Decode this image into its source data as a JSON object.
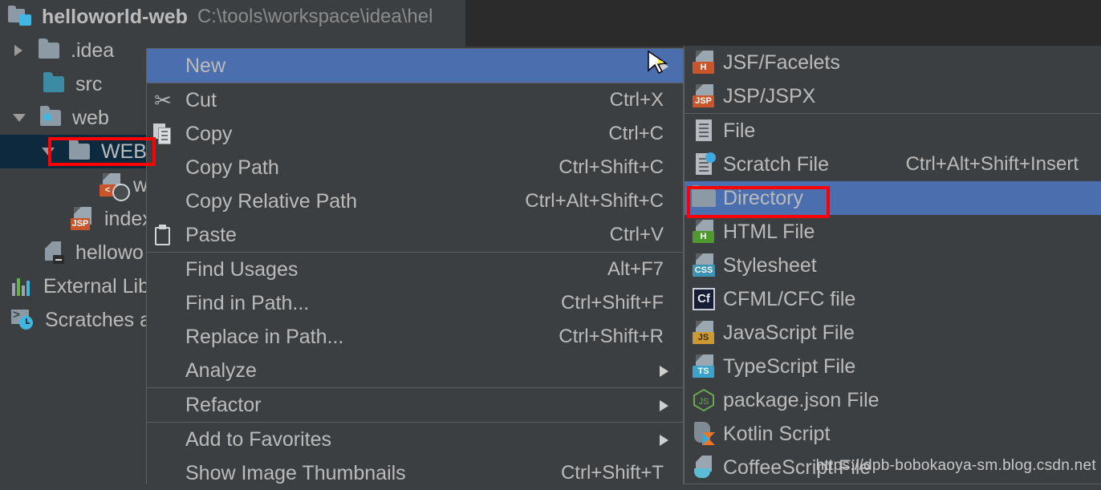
{
  "window": {
    "background_color": "#3c3f41",
    "selection_color": "#4b6eaf",
    "tree_selection_color": "#0d293e",
    "annotation_color": "#fe0000"
  },
  "project_tree": {
    "root": {
      "name": "helloworld-web",
      "path": "C:\\tools\\workspace\\idea\\hel",
      "icon": "project-module-icon"
    },
    "items": [
      {
        "label": ".idea",
        "icon": "folder-icon",
        "indent": 1,
        "expander": "collapsed",
        "selected": false
      },
      {
        "label": "src",
        "icon": "folder-source-icon",
        "indent": 2,
        "expander": "none",
        "selected": false
      },
      {
        "label": "web",
        "icon": "folder-web-icon",
        "indent": 1,
        "expander": "expanded",
        "selected": false
      },
      {
        "label": "WEB-",
        "icon": "folder-icon",
        "indent": 2,
        "expander": "expanded",
        "selected": true
      },
      {
        "label": "w",
        "icon": "xml-web-file-icon",
        "indent": 4,
        "expander": "none",
        "selected": false
      },
      {
        "label": "index",
        "icon": "jsp-file-icon",
        "indent": 3,
        "expander": "none",
        "selected": false
      },
      {
        "label": "hellowo",
        "icon": "module-iml-icon",
        "indent": 2,
        "expander": "none",
        "selected": false
      },
      {
        "label": "External Lib",
        "icon": "external-libraries-icon",
        "indent": 0,
        "expander": "none",
        "selected": false
      },
      {
        "label": "Scratches a",
        "icon": "scratches-icon",
        "indent": 0,
        "expander": "none",
        "selected": false
      }
    ]
  },
  "context_menu": {
    "items": [
      {
        "label": "New",
        "mnemonic": "",
        "accel": "",
        "icon": "",
        "submenu": true,
        "selected": true,
        "separator_after": true
      },
      {
        "label": "Cut",
        "mnemonic": "t",
        "accel": "Ctrl+X",
        "icon": "cut-icon",
        "submenu": false,
        "selected": false,
        "separator_after": false
      },
      {
        "label": "Copy",
        "mnemonic": "C",
        "accel": "Ctrl+C",
        "icon": "copy-icon",
        "submenu": false,
        "selected": false,
        "separator_after": false
      },
      {
        "label": "Copy Path",
        "mnemonic": "o",
        "accel": "Ctrl+Shift+C",
        "icon": "",
        "submenu": false,
        "selected": false,
        "separator_after": false
      },
      {
        "label": "Copy Relative Path",
        "mnemonic": "y",
        "accel": "Ctrl+Alt+Shift+C",
        "icon": "",
        "submenu": false,
        "selected": false,
        "separator_after": false
      },
      {
        "label": "Paste",
        "mnemonic": "P",
        "accel": "Ctrl+V",
        "icon": "paste-icon",
        "submenu": false,
        "selected": false,
        "separator_after": true
      },
      {
        "label": "Find Usages",
        "mnemonic": "U",
        "accel": "Alt+F7",
        "icon": "",
        "submenu": false,
        "selected": false,
        "separator_after": false
      },
      {
        "label": "Find in Path...",
        "mnemonic": "P",
        "accel": "Ctrl+Shift+F",
        "icon": "",
        "submenu": false,
        "selected": false,
        "separator_after": false
      },
      {
        "label": "Replace in Path...",
        "mnemonic": "a",
        "accel": "Ctrl+Shift+R",
        "icon": "",
        "submenu": false,
        "selected": false,
        "separator_after": false
      },
      {
        "label": "Analyze",
        "mnemonic": "z",
        "accel": "",
        "icon": "",
        "submenu": true,
        "selected": false,
        "separator_after": true
      },
      {
        "label": "Refactor",
        "mnemonic": "R",
        "accel": "",
        "icon": "",
        "submenu": true,
        "selected": false,
        "separator_after": true
      },
      {
        "label": "Add to Favorites",
        "mnemonic": "F",
        "accel": "",
        "icon": "",
        "submenu": true,
        "selected": false,
        "separator_after": false
      },
      {
        "label": "Show Image Thumbnails",
        "mnemonic": "T",
        "accel": "Ctrl+Shift+T",
        "icon": "",
        "submenu": false,
        "selected": false,
        "separator_after": false
      }
    ]
  },
  "new_submenu": {
    "items": [
      {
        "label": "JSF/Facelets",
        "accel": "",
        "icon": "jsf-facelets-file-icon",
        "selected": false,
        "separator_after": false
      },
      {
        "label": "JSP/JSPX",
        "accel": "",
        "icon": "jsp-file-icon",
        "selected": false,
        "separator_after": true
      },
      {
        "label": "File",
        "accel": "",
        "icon": "file-icon",
        "selected": false,
        "separator_after": false
      },
      {
        "label": "Scratch File",
        "accel": "Ctrl+Alt+Shift+Insert",
        "icon": "scratch-file-icon",
        "selected": false,
        "separator_after": false
      },
      {
        "label": "Directory",
        "accel": "",
        "icon": "folder-icon",
        "selected": true,
        "separator_after": false
      },
      {
        "label": "HTML File",
        "accel": "",
        "icon": "html-file-icon",
        "selected": false,
        "separator_after": false
      },
      {
        "label": "Stylesheet",
        "accel": "",
        "icon": "css-file-icon",
        "selected": false,
        "separator_after": false
      },
      {
        "label": "CFML/CFC file",
        "accel": "",
        "icon": "cfml-file-icon",
        "selected": false,
        "separator_after": false
      },
      {
        "label": "JavaScript File",
        "accel": "",
        "icon": "javascript-file-icon",
        "selected": false,
        "separator_after": false
      },
      {
        "label": "TypeScript File",
        "accel": "",
        "icon": "typescript-file-icon",
        "selected": false,
        "separator_after": false
      },
      {
        "label": "package.json File",
        "accel": "",
        "icon": "nodejs-package-icon",
        "selected": false,
        "separator_after": false
      },
      {
        "label": "Kotlin Script",
        "accel": "",
        "icon": "kotlin-script-icon",
        "selected": false,
        "separator_after": false
      },
      {
        "label": "CoffeeScript File",
        "accel": "",
        "icon": "coffeescript-file-icon",
        "selected": false,
        "separator_after": false
      }
    ]
  },
  "watermark": {
    "text": "https://dpb-bobokaoya-sm.blog.csdn.net"
  }
}
